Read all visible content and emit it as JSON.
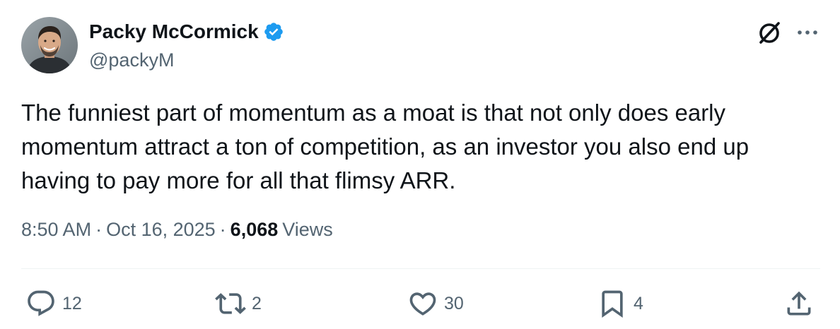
{
  "author": {
    "display_name": "Packy McCormick",
    "handle": "@packyM"
  },
  "tweet": {
    "text": "The funniest part of momentum as a moat is that not only does early momentum attract a ton of competition, as an investor you also end up having to pay more for all that flimsy ARR."
  },
  "meta": {
    "time": "8:50 AM",
    "separator": "·",
    "date": "Oct 16, 2025",
    "views_count": "6,068",
    "views_label": "Views"
  },
  "actions": {
    "replies": "12",
    "reposts": "2",
    "likes": "30",
    "bookmarks": "4"
  },
  "colors": {
    "text": "#0f1419",
    "secondary": "#536471",
    "verified": "#1d9bf0",
    "divider": "#eff3f4"
  },
  "icons": [
    "verified-badge-icon",
    "grok-icon",
    "more-icon",
    "reply-icon",
    "repost-icon",
    "like-icon",
    "bookmark-icon",
    "share-icon"
  ]
}
